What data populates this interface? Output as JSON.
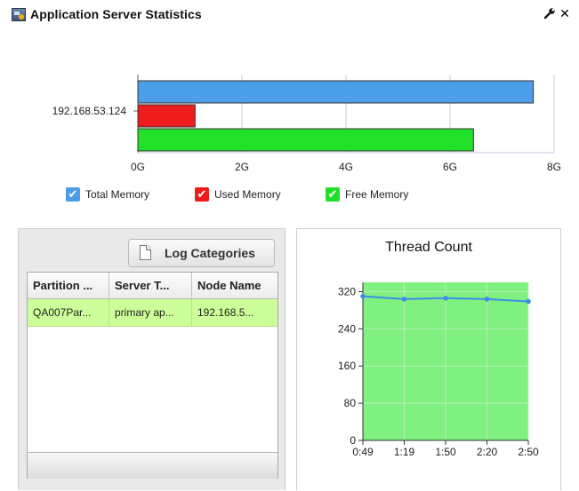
{
  "header": {
    "title": "Application Server Statistics",
    "wrench_icon": "wrench-icon",
    "close_icon": "close-icon",
    "close_glyph": "✕"
  },
  "memory_chart": {
    "category": "192.168.53.124",
    "x_ticks": [
      "0G",
      "2G",
      "4G",
      "6G",
      "8G"
    ],
    "legend": [
      {
        "label": "Total Memory",
        "color": "#4d9ee8"
      },
      {
        "label": "Used Memory",
        "color": "#ee1c1c"
      },
      {
        "label": "Free Memory",
        "color": "#22e02a"
      }
    ]
  },
  "log_categories_button": {
    "label": "Log Categories",
    "icon": "document-icon"
  },
  "grid": {
    "columns": [
      "Partition ...",
      "Server T...",
      "Node Name"
    ],
    "rows": [
      [
        "QA007Par...",
        "primary ap...",
        "192.168.5..."
      ]
    ],
    "selected_row_color": "#ccff99"
  },
  "thread_chart_title": "Thread Count",
  "chart_data": [
    {
      "type": "bar",
      "orientation": "horizontal",
      "categories": [
        "192.168.53.124"
      ],
      "series": [
        {
          "name": "Total Memory",
          "values": [
            7.6
          ],
          "color": "#4d9ee8"
        },
        {
          "name": "Used Memory",
          "values": [
            1.1
          ],
          "color": "#ee1c1c"
        },
        {
          "name": "Free Memory",
          "values": [
            6.45
          ],
          "color": "#22e02a"
        }
      ],
      "xlim": [
        0,
        8
      ],
      "x_ticks": [
        "0G",
        "2G",
        "4G",
        "6G",
        "8G"
      ],
      "unit": "G",
      "grid": true,
      "legend": "bottom"
    },
    {
      "type": "line",
      "title": "Thread Count",
      "x": [
        "0:49",
        "1:19",
        "1:50",
        "2:20",
        "2:50"
      ],
      "series": [
        {
          "values": [
            310,
            304,
            306,
            304,
            299
          ],
          "color": "#3d8ee8"
        }
      ],
      "ylim": [
        0,
        340
      ],
      "y_ticks": [
        0,
        80,
        160,
        240,
        320
      ],
      "plot_background": "#80f080",
      "grid": true
    }
  ]
}
